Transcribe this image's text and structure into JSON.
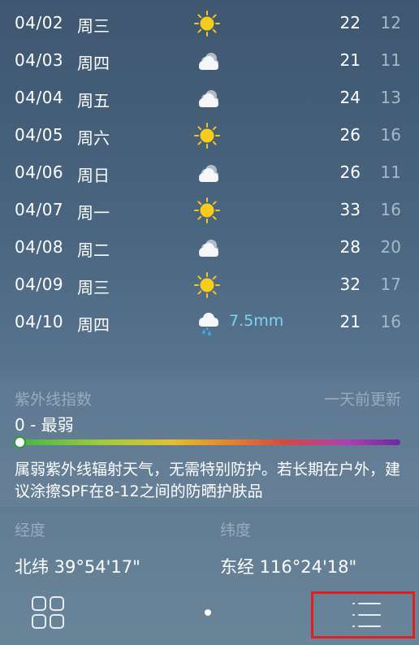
{
  "forecast": [
    {
      "date": "04/02",
      "weekday": "周三",
      "icon": "sun-icon",
      "precip": "",
      "high": "22",
      "low": "12"
    },
    {
      "date": "04/03",
      "weekday": "周四",
      "icon": "cloudy-icon",
      "precip": "",
      "high": "21",
      "low": "11"
    },
    {
      "date": "04/04",
      "weekday": "周五",
      "icon": "cloudy-icon",
      "precip": "",
      "high": "24",
      "low": "13"
    },
    {
      "date": "04/05",
      "weekday": "周六",
      "icon": "sun-icon",
      "precip": "",
      "high": "26",
      "low": "16"
    },
    {
      "date": "04/06",
      "weekday": "周日",
      "icon": "cloudy-icon",
      "precip": "",
      "high": "26",
      "low": "11"
    },
    {
      "date": "04/07",
      "weekday": "周一",
      "icon": "sun-icon",
      "precip": "",
      "high": "33",
      "low": "16"
    },
    {
      "date": "04/08",
      "weekday": "周二",
      "icon": "cloudy-icon",
      "precip": "",
      "high": "28",
      "low": "20"
    },
    {
      "date": "04/09",
      "weekday": "周三",
      "icon": "sun-icon",
      "precip": "",
      "high": "32",
      "low": "17"
    },
    {
      "date": "04/10",
      "weekday": "周四",
      "icon": "rain-icon",
      "precip": "7.5mm",
      "high": "21",
      "low": "16"
    }
  ],
  "uv": {
    "title": "紫外线指数",
    "updated": "一天前更新",
    "level": "0 - 最弱",
    "level_fraction": 0,
    "description": "属弱紫外线辐射天气，无需特别防护。若长期在户外，建议涂擦SPF在8-12之间的防晒护肤品"
  },
  "location": {
    "label1": "经度",
    "value1": "北纬 39°54'17\"",
    "label2": "纬度",
    "value2": "东经 116°24'18\""
  },
  "bottom_bar": {
    "left_icon": "grid-icon",
    "right_icon": "menu-list-icon"
  },
  "colors": {
    "precip_text": "#7fd3f4",
    "low_temp_text": "#a8b7c6",
    "highlight_border": "#e02020"
  }
}
